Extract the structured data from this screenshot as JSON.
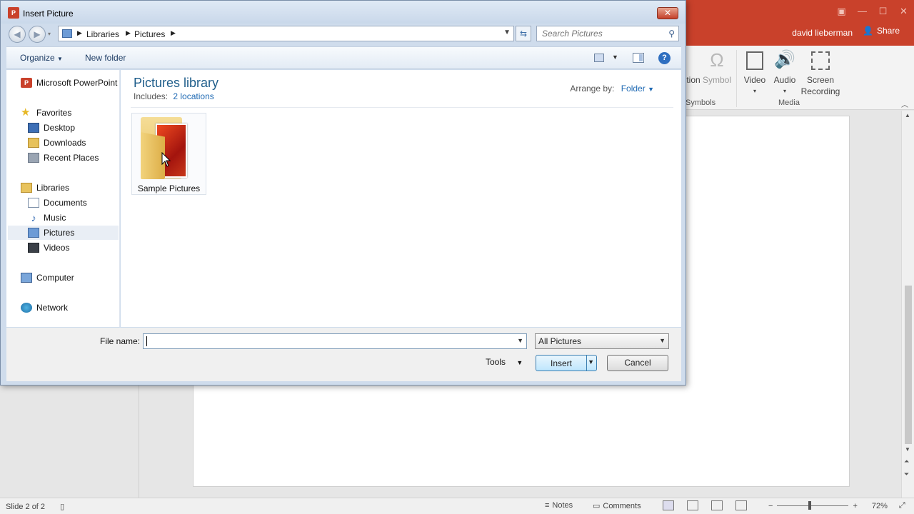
{
  "ppt": {
    "user_name": "david lieberman",
    "share_label": "Share",
    "ribbon": {
      "symbols_partial": "tion",
      "symbol_label": "Symbol",
      "symbols_group_partial": "Symbols",
      "video_label": "Video",
      "audio_label": "Audio",
      "screen_recording_label_1": "Screen",
      "screen_recording_label_2": "Recording",
      "media_group": "Media"
    },
    "status": {
      "slide_info": "Slide 2 of 2",
      "notes": "Notes",
      "comments": "Comments",
      "zoom": "72%"
    }
  },
  "dialog": {
    "title": "Insert Picture",
    "close_glyph": "✕",
    "breadcrumbs": [
      "Libraries",
      "Pictures"
    ],
    "search_placeholder": "Search Pictures",
    "toolbar": {
      "organize": "Organize",
      "new_folder": "New folder"
    },
    "nav": {
      "app": "Microsoft PowerPoint",
      "favorites": "Favorites",
      "desktop": "Desktop",
      "downloads": "Downloads",
      "recent_places": "Recent Places",
      "libraries": "Libraries",
      "documents": "Documents",
      "music": "Music",
      "pictures": "Pictures",
      "videos": "Videos",
      "computer": "Computer",
      "network": "Network"
    },
    "content": {
      "library_title": "Pictures library",
      "includes_label": "Includes:",
      "includes_link": "2 locations",
      "arrange_by_label": "Arrange by:",
      "arrange_by_value": "Folder",
      "folder_name": "Sample Pictures"
    },
    "bottom": {
      "file_name_label": "File name:",
      "file_name_value": "",
      "file_type": "All Pictures",
      "tools": "Tools",
      "insert": "Insert",
      "cancel": "Cancel"
    }
  }
}
